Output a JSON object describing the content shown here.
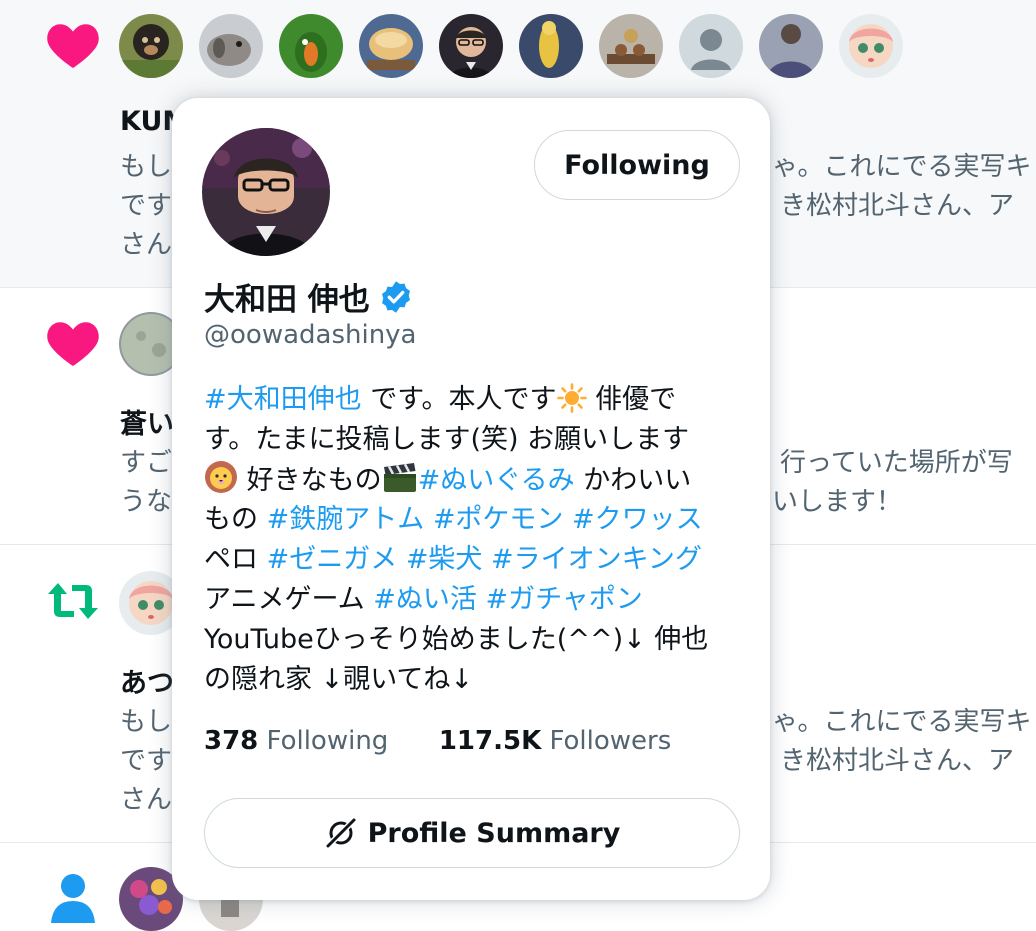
{
  "colors": {
    "accent": "#1d9bf0",
    "like": "#f91880",
    "retweet": "#00ba7c",
    "muted": "#536471"
  },
  "notifications": [
    {
      "type": "like",
      "icon": "heart-icon",
      "name": "KUM",
      "lines": [
        "もし",
        "です",
        "さん"
      ],
      "right_lines": [
        "ゃ。これにでる実写キ",
        "き松村北斗さん、ア"
      ]
    },
    {
      "type": "like",
      "icon": "heart-icon",
      "name": "蒼い",
      "lines": [
        "すご",
        "うな"
      ],
      "right_lines": [
        "行っていた場所が写",
        "いします！"
      ]
    },
    {
      "type": "retweet",
      "icon": "retweet-icon",
      "name": "あつ",
      "lines": [
        "もし",
        "です",
        "さん"
      ],
      "right_lines": [
        "ゃ。これにでる実写キ",
        "き松村北斗さん、ア"
      ]
    },
    {
      "type": "follow",
      "icon": "person-icon"
    }
  ],
  "hover_card": {
    "follow_button": "Following",
    "display_name": "大和田 伸也",
    "handle": "@oowadashinya",
    "bio": {
      "l1": {
        "t1": "#大和田伸也",
        "t2": " です。本人です",
        "t3": " 俳優で"
      },
      "l2": {
        "t1": "す。たまに投稿します(笑) お願いします"
      },
      "l3": {
        "t1": " 好きなもの",
        "t2": "#ぬいぐるみ",
        "t3": " かわいい"
      },
      "l4": {
        "t1": "もの ",
        "t2": "#鉄腕アトム",
        "t3": " ",
        "t4": "#ポケモン",
        "t5": " ",
        "t6": "#クワッス"
      },
      "l5": {
        "t1": "ペロ ",
        "t2": "#ゼニガメ",
        "t3": " ",
        "t4": "#柴犬",
        "t5": " ",
        "t6": "#ライオンキング"
      },
      "l6": {
        "t1": "アニメゲーム ",
        "t2": "#ぬい活",
        "t3": " ",
        "t4": "#ガチャポン"
      },
      "l7": {
        "t1": "YouTubeひっそり始めました(^^)↓ 伸也"
      },
      "l8": {
        "t1": "の隠れ家 ↓覗いてね↓"
      }
    },
    "following_count": "378",
    "following_label": " Following",
    "followers_count": "117.5K",
    "followers_label": " Followers",
    "summary_button": "Profile Summary"
  }
}
